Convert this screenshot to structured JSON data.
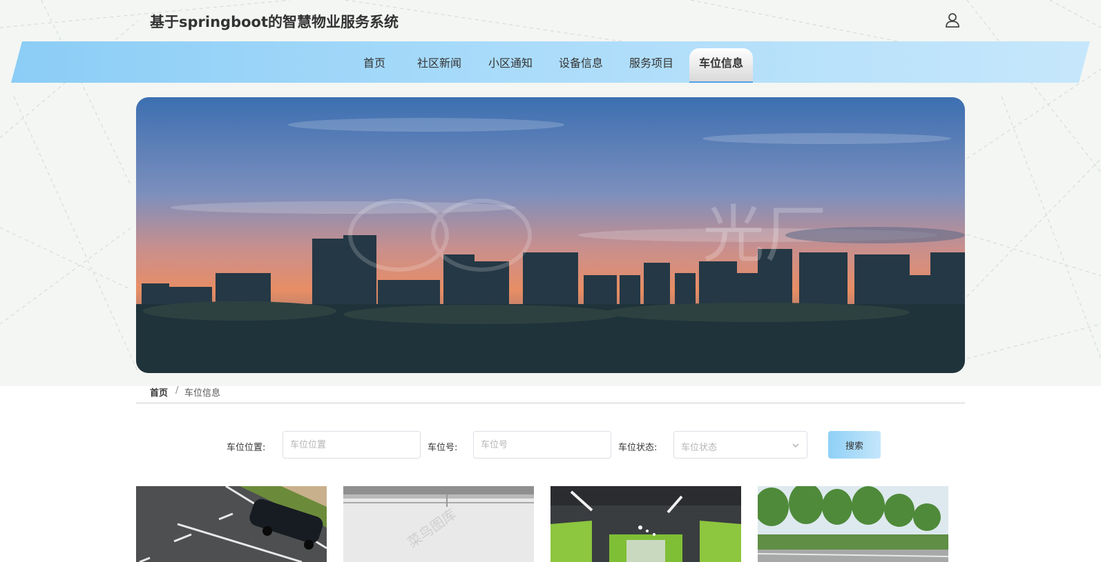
{
  "header": {
    "title": "基于springboot的智慧物业服务系统",
    "user_icon": "user-icon"
  },
  "nav": {
    "items": [
      {
        "label": "首页"
      },
      {
        "label": "社区新闻"
      },
      {
        "label": "小区通知"
      },
      {
        "label": "设备信息"
      },
      {
        "label": "服务项目"
      },
      {
        "label": "车位信息"
      }
    ],
    "active": "车位信息"
  },
  "banner": {
    "watermark": "光厂"
  },
  "breadcrumb": {
    "home": "首页",
    "separator": "/",
    "current": "车位信息"
  },
  "search": {
    "location_label": "车位位置:",
    "location_placeholder": "车位位置",
    "number_label": "车位号:",
    "number_placeholder": "车位号",
    "status_label": "车位状态:",
    "status_placeholder": "车位状态",
    "button_label": "搜索"
  },
  "cards": {
    "watermark": "菜鸟图库"
  },
  "colors": {
    "nav_gradient_start": "#8bcdf6",
    "nav_gradient_end": "#c6e7fb",
    "active_underline": "#4ea2e8",
    "top_background": "#f3f6f3"
  }
}
